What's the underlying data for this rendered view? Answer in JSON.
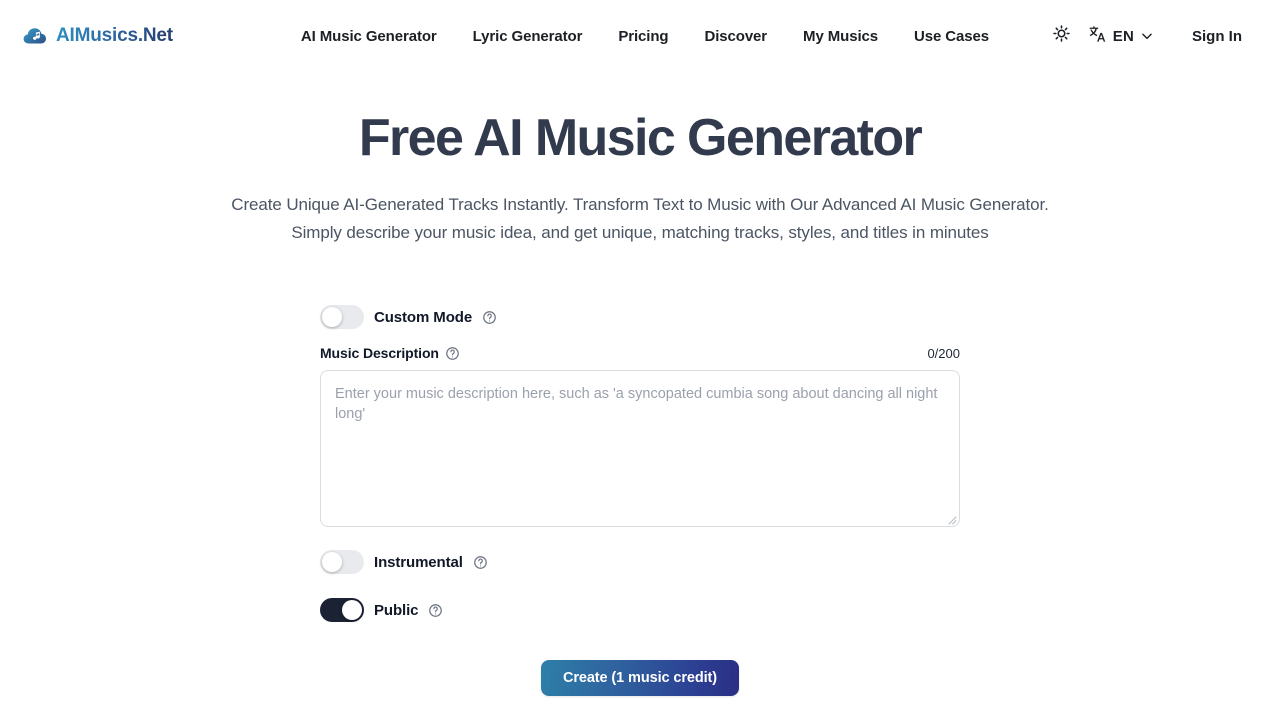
{
  "brand": {
    "name": "AIMusics.Net",
    "icon": "cloud-music-note-icon"
  },
  "nav": {
    "items": [
      {
        "label": "AI Music Generator"
      },
      {
        "label": "Lyric Generator"
      },
      {
        "label": "Pricing"
      },
      {
        "label": "Discover"
      },
      {
        "label": "My Musics"
      },
      {
        "label": "Use Cases"
      }
    ]
  },
  "header_right": {
    "theme_toggle_icon": "sun-icon",
    "language_icon": "translate-icon",
    "language_code": "EN",
    "language_chevron_icon": "chevron-down-icon",
    "sign_in_label": "Sign In"
  },
  "hero": {
    "title": "Free AI Music Generator",
    "subtitle": "Create Unique AI-Generated Tracks Instantly. Transform Text to Music with Our Advanced AI Music Generator. Simply describe your music idea, and get unique, matching tracks, styles, and titles in minutes"
  },
  "form": {
    "custom_mode": {
      "label": "Custom Mode",
      "state": "off",
      "help_icon": "help-circle-icon"
    },
    "music_description": {
      "label": "Music Description",
      "help_icon": "help-circle-icon",
      "counter": "0/200",
      "value": "",
      "placeholder": "Enter your music description here, such as 'a syncopated cumbia song about dancing all night long'"
    },
    "instrumental": {
      "label": "Instrumental",
      "state": "off",
      "help_icon": "help-circle-icon"
    },
    "public": {
      "label": "Public",
      "state": "on",
      "help_icon": "help-circle-icon"
    },
    "create_button": {
      "label": "Create (1 music credit)"
    }
  },
  "colors": {
    "brand_gradient_start": "#2c8fbf",
    "brand_gradient_end": "#243b6b",
    "heading": "#323a4d",
    "button_gradient_start": "#2e7fa8",
    "button_gradient_end": "#2a2f84",
    "toggle_on": "#1b2233",
    "toggle_off": "#e8eaee"
  }
}
